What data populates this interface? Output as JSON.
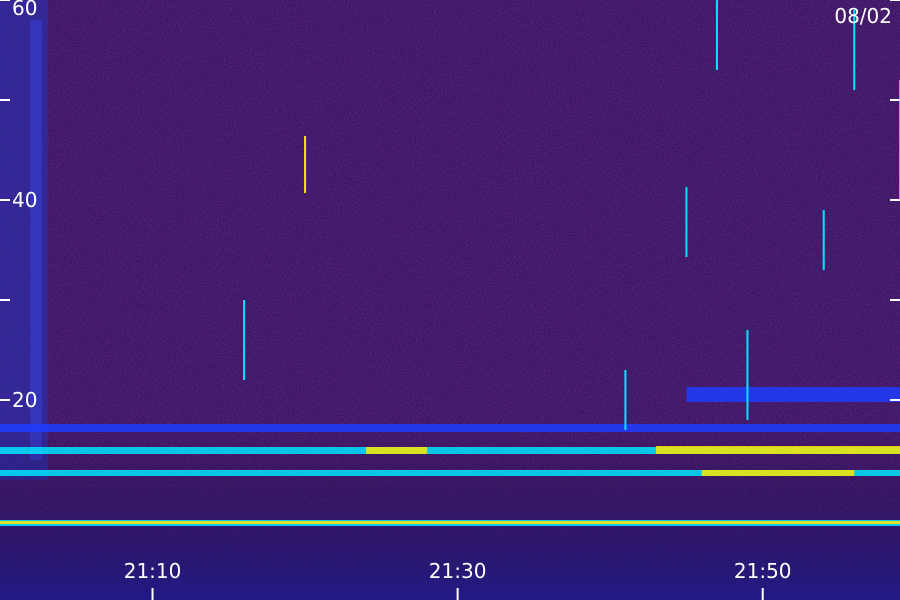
{
  "chart_data": {
    "type": "heatmap",
    "title": "",
    "date_label": "08/02",
    "xlabel": "",
    "ylabel": "",
    "xlim": [
      "21:00",
      "21:59"
    ],
    "ylim": [
      0,
      60
    ],
    "y_ticks": [
      {
        "value": 60,
        "label": "60"
      },
      {
        "value": 50,
        "label": ""
      },
      {
        "value": 40,
        "label": "40"
      },
      {
        "value": 30,
        "label": ""
      },
      {
        "value": 20,
        "label": "20"
      }
    ],
    "x_ticks": [
      {
        "value": "21:10",
        "label": "21:10"
      },
      {
        "value": "21:30",
        "label": "21:30"
      },
      {
        "value": "21:50",
        "label": "21:50"
      }
    ],
    "colors": {
      "background": "#2a0a4a",
      "low": "#3a1478",
      "mid": "#1e3cff",
      "high": "#00e5ff",
      "peak": "#ffe600"
    },
    "bands": [
      {
        "start": "21:00",
        "end": "21:59",
        "y_low": 16.8,
        "y_high": 17.6,
        "intensity": "mid"
      },
      {
        "start": "21:00",
        "end": "21:59",
        "y_low": 14.6,
        "y_high": 15.3,
        "intensity": "high"
      },
      {
        "start": "21:24",
        "end": "21:28",
        "y_low": 14.6,
        "y_high": 15.3,
        "intensity": "peak"
      },
      {
        "start": "21:43",
        "end": "21:59",
        "y_low": 14.6,
        "y_high": 15.4,
        "intensity": "peak"
      },
      {
        "start": "21:00",
        "end": "21:59",
        "y_low": 12.4,
        "y_high": 13.0,
        "intensity": "high"
      },
      {
        "start": "21:46",
        "end": "21:56",
        "y_low": 12.4,
        "y_high": 13.0,
        "intensity": "peak"
      },
      {
        "start": "21:00",
        "end": "21:59",
        "y_low": 7.4,
        "y_high": 8.0,
        "intensity": "high"
      },
      {
        "start": "21:00",
        "end": "21:59",
        "y_low": 7.6,
        "y_high": 7.9,
        "intensity": "peak"
      },
      {
        "start": "21:45",
        "end": "21:59",
        "y_low": 19.8,
        "y_high": 21.3,
        "intensity": "mid"
      }
    ],
    "spikes": [
      {
        "time": "21:20",
        "y_low": 40.7,
        "y_high": 46.4,
        "intensity": "peak"
      },
      {
        "time": "21:16",
        "y_low": 22.0,
        "y_high": 30.0,
        "intensity": "high"
      },
      {
        "time": "21:41",
        "y_low": 17.0,
        "y_high": 23.0,
        "intensity": "high"
      },
      {
        "time": "21:45",
        "y_low": 34.3,
        "y_high": 41.3,
        "intensity": "high"
      },
      {
        "time": "21:47",
        "y_low": 53.0,
        "y_high": 60.0,
        "intensity": "high"
      },
      {
        "time": "21:54",
        "y_low": 33.0,
        "y_high": 39.0,
        "intensity": "high"
      },
      {
        "time": "21:56",
        "y_low": 51.0,
        "y_high": 59.0,
        "intensity": "high"
      },
      {
        "time": "21:49",
        "y_low": 18.0,
        "y_high": 27.0,
        "intensity": "high"
      },
      {
        "time": "21:59",
        "y_low": 40.0,
        "y_high": 52.0,
        "intensity": "high"
      }
    ]
  }
}
